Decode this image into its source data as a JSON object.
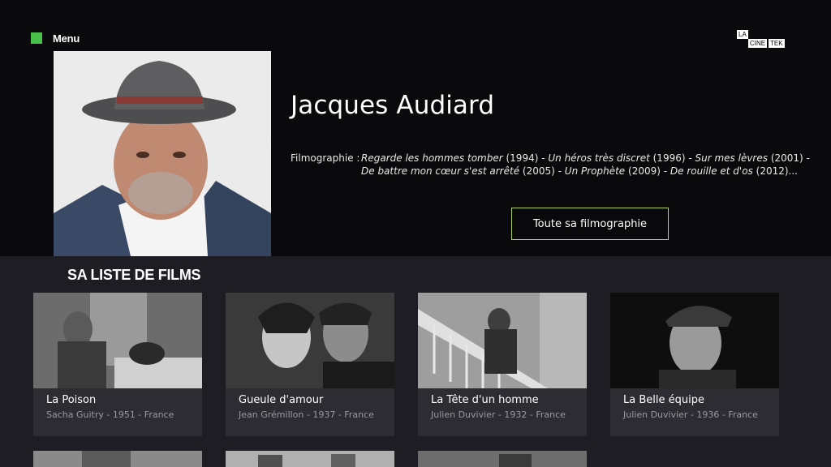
{
  "nav": {
    "menu_label": "Menu"
  },
  "logo": {
    "line1": "LA",
    "line2a": "CINE",
    "line2b": "TEK"
  },
  "director": {
    "name": "Jacques Audiard",
    "filmography_label": "Filmographie :",
    "filmography_parts": [
      {
        "t": "Regarde les hommes tomber",
        "y": " (1994) - "
      },
      {
        "t": "Un héros très discret",
        "y": " (1996) - "
      },
      {
        "t": "Sur mes lèvres",
        "y": " (2001) - "
      },
      {
        "t": "De battre mon cœur s'est arrêté",
        "y": " (2005) - "
      },
      {
        "t": "Un Prophète",
        "y": " (2009) - "
      },
      {
        "t": "De rouille et d'os",
        "y": " (2012)..."
      }
    ],
    "full_filmography_button": "Toute sa filmographie"
  },
  "list": {
    "title": "SA LISTE DE FILMS",
    "films": [
      {
        "title": "La Poison",
        "meta": "Sacha Guitry - 1951 - France"
      },
      {
        "title": "Gueule d'amour",
        "meta": "Jean Grémillon - 1937 - France"
      },
      {
        "title": "La Tête d'un homme",
        "meta": "Julien Duvivier - 1932 - France"
      },
      {
        "title": "La Belle équipe",
        "meta": "Julien Duvivier - 1936 - France"
      }
    ]
  },
  "colors": {
    "accent_green": "#48c04a",
    "button_border": "#b4d65a",
    "card_bg": "#2d2c32"
  }
}
